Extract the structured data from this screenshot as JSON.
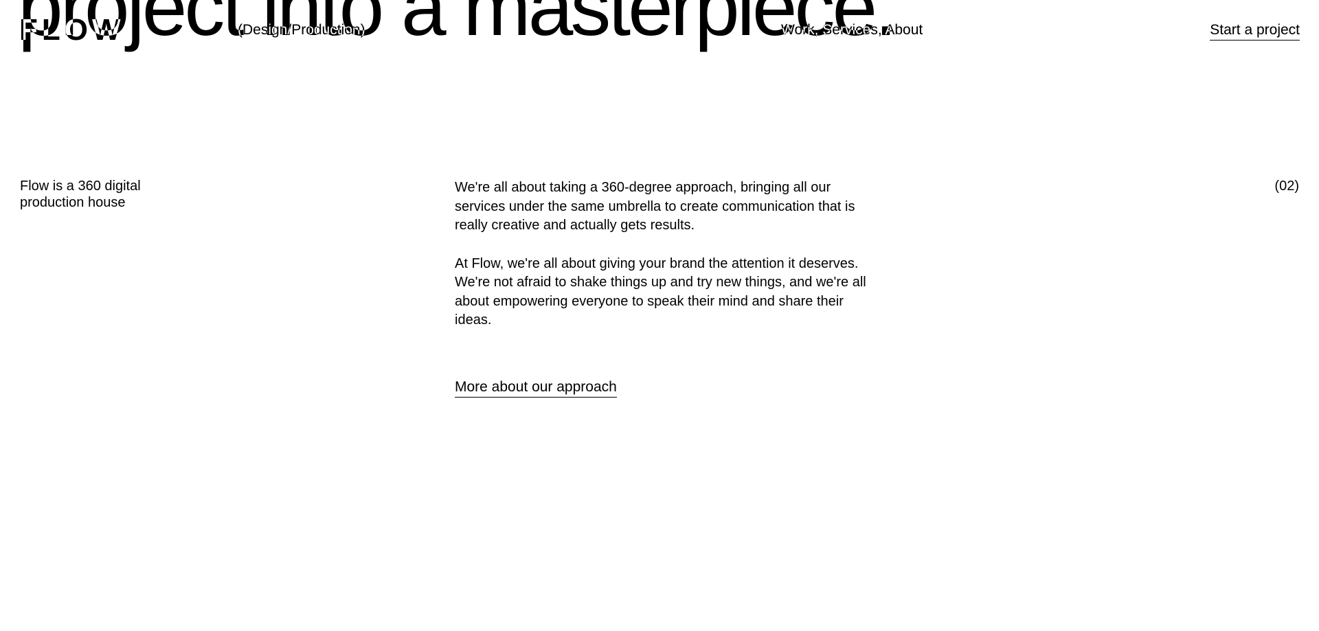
{
  "hero": {
    "headline": "project into a masterpiece."
  },
  "header": {
    "logo": "FLOW",
    "tagline": "(Design/Production)",
    "nav": [
      {
        "label": "Work"
      },
      {
        "label": "Services"
      },
      {
        "label": "About"
      }
    ],
    "nav_separator": ", ",
    "cta_label": "Start a project"
  },
  "intro": {
    "label": "Flow is a 360 digital production house",
    "section_number": "(02)",
    "paragraphs": [
      "We're all about taking a 360-degree approach, bringing all our services under the same umbrella to create communication that is really creative and actually gets results.",
      "At Flow, we're all about giving your brand the attention it deserves. We're not afraid to shake things up and try new things, and we're all about empowering everyone to speak their mind and share their ideas."
    ],
    "more_link": "More about our approach"
  }
}
